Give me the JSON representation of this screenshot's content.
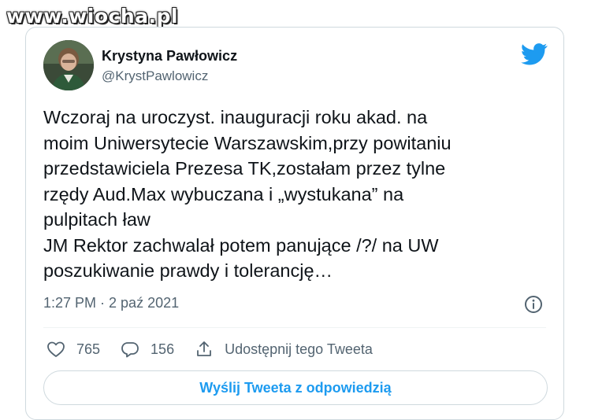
{
  "watermark": "www.wiocha.pl",
  "tweet": {
    "author_name": "Krystyna Pawłowicz",
    "author_handle": "@KrystPawlowicz",
    "text_lines": [
      "Wczoraj na uroczyst. inauguracji roku akad. na",
      "moim Uniwersytecie Warszawskim,przy powitaniu",
      "przedstawiciela Prezesa TK,zostałam przez tylne",
      "rzędy Aud.Max wybuczana i „wystukana” na",
      "pulpitach ław",
      "JM Rektor zachwalał potem panujące /?/ na UW",
      "poszukiwanie prawdy i tolerancję…"
    ],
    "timestamp": "1:27 PM · 2 paź 2021",
    "likes": "765",
    "replies": "156",
    "share_label": "Udostępnij tego Tweeta",
    "reply_button_label": "Wyślij Tweeta z odpowiedzią"
  },
  "icons": {
    "brand": "twitter-bird-icon",
    "info": "info-icon",
    "like": "heart-icon",
    "reply": "reply-bubble-icon",
    "share": "share-icon"
  },
  "colors": {
    "twitter_blue": "#1d9bf0",
    "secondary_text": "#536471",
    "border": "#cfd9de"
  }
}
